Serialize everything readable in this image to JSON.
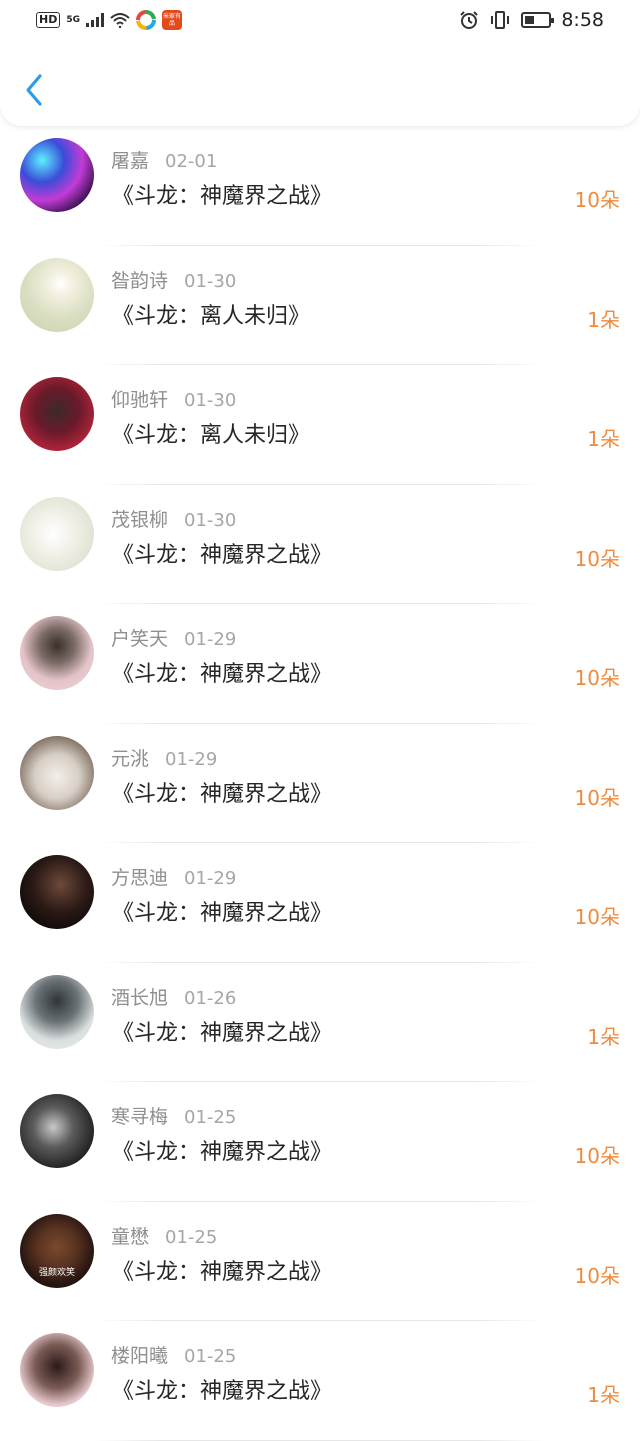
{
  "status_bar": {
    "hd": "HD",
    "network": "5G",
    "time": "8:58",
    "app_badge": "米家有品"
  },
  "colors": {
    "accent": "#2f9ae8",
    "amount": "#f28a3c"
  },
  "header": {
    "back_icon": "chevron-left-icon"
  },
  "entries": [
    {
      "name": "屠嘉",
      "date": "02-01",
      "book": "《斗龙：神魔界之战》",
      "amount": "10朵",
      "avatar_caption": ""
    },
    {
      "name": "昝韵诗",
      "date": "01-30",
      "book": "《斗龙：离人未归》",
      "amount": "1朵",
      "avatar_caption": ""
    },
    {
      "name": "仰驰轩",
      "date": "01-30",
      "book": "《斗龙：离人未归》",
      "amount": "1朵",
      "avatar_caption": ""
    },
    {
      "name": "茂银柳",
      "date": "01-30",
      "book": "《斗龙：神魔界之战》",
      "amount": "10朵",
      "avatar_caption": ""
    },
    {
      "name": "户笑天",
      "date": "01-29",
      "book": "《斗龙：神魔界之战》",
      "amount": "10朵",
      "avatar_caption": ""
    },
    {
      "name": "元洮",
      "date": "01-29",
      "book": "《斗龙：神魔界之战》",
      "amount": "10朵",
      "avatar_caption": ""
    },
    {
      "name": "方思迪",
      "date": "01-29",
      "book": "《斗龙：神魔界之战》",
      "amount": "10朵",
      "avatar_caption": ""
    },
    {
      "name": "酒长旭",
      "date": "01-26",
      "book": "《斗龙：神魔界之战》",
      "amount": "1朵",
      "avatar_caption": ""
    },
    {
      "name": "寒寻梅",
      "date": "01-25",
      "book": "《斗龙：神魔界之战》",
      "amount": "10朵",
      "avatar_caption": ""
    },
    {
      "name": "童懋",
      "date": "01-25",
      "book": "《斗龙：神魔界之战》",
      "amount": "10朵",
      "avatar_caption": "强颜欢笑"
    },
    {
      "name": "楼阳曦",
      "date": "01-25",
      "book": "《斗龙：神魔界之战》",
      "amount": "1朵",
      "avatar_caption": ""
    }
  ]
}
